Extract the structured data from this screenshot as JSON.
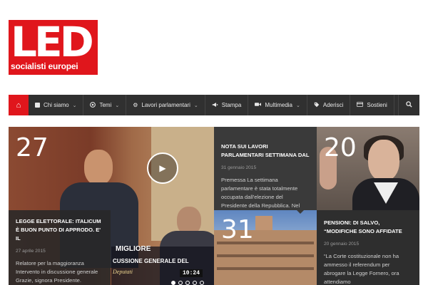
{
  "logo": {
    "big": "LED",
    "small": "socialisti europei"
  },
  "nav": {
    "items": [
      {
        "icon": "square-icon",
        "glyph": "■",
        "label": "Chi siamo",
        "dropdown": true
      },
      {
        "icon": "play-circle-icon",
        "glyph": "◉",
        "label": "Temi",
        "dropdown": true
      },
      {
        "icon": "gear-icon",
        "glyph": "⚙",
        "label": "Lavori parlamentari",
        "dropdown": true
      },
      {
        "icon": "megaphone-icon",
        "glyph": "📢",
        "label": "Stampa",
        "dropdown": false
      },
      {
        "icon": "video-camera-icon",
        "glyph": "■",
        "label": "Multimedia",
        "dropdown": true
      },
      {
        "icon": "tag-icon",
        "glyph": "◆",
        "label": "Aderisci",
        "dropdown": false
      },
      {
        "icon": "credit-card-icon",
        "glyph": "▭",
        "label": "Sostieni",
        "dropdown": false
      }
    ],
    "home_glyph": "⌂",
    "search_glyph": "⌕",
    "accent": "#e0161c",
    "bar_color": "#303030"
  },
  "tiles": {
    "video": {
      "number": "27",
      "caption_line1": "MIGLIORE",
      "caption_line2": "CUSSIONE GENERALE DEL",
      "logo_text": "Deputati",
      "time": "10:24",
      "title": "LEGGE ELETTORALE: ITALICUM È BUON PUNTO DI APPRODO. E' IL",
      "date": "27 aprile 2015",
      "excerpt": "Relatore per la maggioranza Intervento in discussione generale Grazie, signora Presidente.",
      "slide_count": 5,
      "active_slide": 1
    },
    "top_mid": {
      "title": "NOTA SUI LAVORI PARLAMENTARI SETTIMANA DAL",
      "date": "31 gennaio 2015",
      "excerpt": "Premessa La settimana parlamentare è stata totalmente occupata dall'elezione del Presidente della Repubblica. Nel"
    },
    "top_right": {
      "number": "20"
    },
    "bottom_mid": {
      "number": "31"
    },
    "bottom_right": {
      "title": "PENSIONI: DI SALVO, “MODIFICHE SONO AFFIDATE",
      "date": "20 gennaio 2015",
      "excerpt": "“La Corte costituzionale non ha ammesso il referendum per abrogare la Legge Fornero, ora attendiamo"
    }
  }
}
